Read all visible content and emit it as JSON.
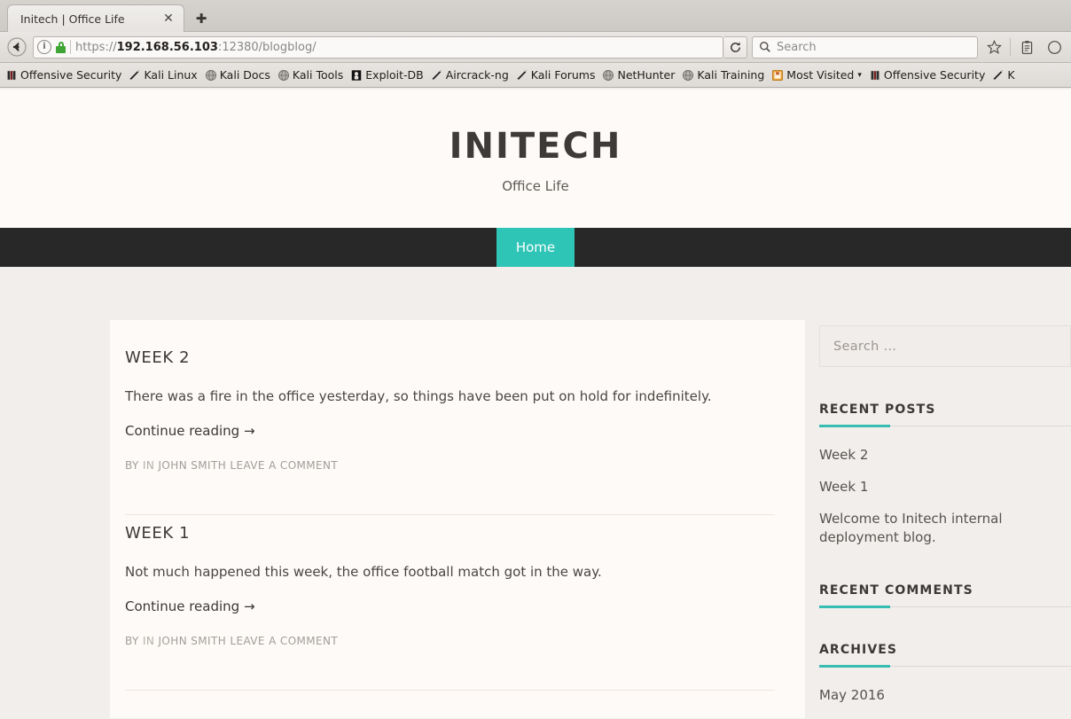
{
  "browser": {
    "tab": {
      "title": "Initech | Office Life",
      "close_icon": "close-icon",
      "newtab_icon": "plus-icon"
    },
    "back_icon": "back-arrow-icon",
    "identity_icon": "info-icon",
    "lock_icon": "lock-icon",
    "url": {
      "scheme": "https://",
      "host": "192.168.56.103",
      "rest": ":12380/blogblog/"
    },
    "reload_icon": "reload-icon",
    "search": {
      "placeholder": "Search",
      "icon": "search-icon"
    },
    "bookmark_star_icon": "star-icon",
    "library_icon": "clipboard-icon",
    "bookmarks": [
      {
        "label": "Offensive Security",
        "icon": "offsec-icon",
        "caret": false
      },
      {
        "label": "Kali Linux",
        "icon": "dragon-icon",
        "caret": false
      },
      {
        "label": "Kali Docs",
        "icon": "globe-icon",
        "caret": false
      },
      {
        "label": "Kali Tools",
        "icon": "globe-icon",
        "caret": false
      },
      {
        "label": "Exploit-DB",
        "icon": "exploitdb-icon",
        "caret": false
      },
      {
        "label": "Aircrack-ng",
        "icon": "dragon-icon",
        "caret": false
      },
      {
        "label": "Kali Forums",
        "icon": "dragon-icon",
        "caret": false
      },
      {
        "label": "NetHunter",
        "icon": "globe-icon",
        "caret": false
      },
      {
        "label": "Kali Training",
        "icon": "globe-icon",
        "caret": false
      },
      {
        "label": "Most Visited",
        "icon": "bookmark-folder-icon",
        "caret": true
      },
      {
        "label": "Offensive Security",
        "icon": "offsec-icon",
        "caret": false
      },
      {
        "label": "K",
        "icon": "dragon-icon",
        "caret": false
      }
    ]
  },
  "site": {
    "title": "INITECH",
    "tagline": "Office Life",
    "nav": [
      {
        "label": "Home",
        "active": true
      }
    ],
    "accent_color": "#2ec4b6",
    "nav_bg_color": "#282828",
    "header_bg_color": "#fdfaf7",
    "page_bg_color": "#f1eeec"
  },
  "posts": [
    {
      "title": "WEEK 2",
      "excerpt": "There was a fire in the office yesterday, so things have been put on hold for indefinitely.",
      "more": "Continue reading →",
      "meta_by": "BY",
      "meta_in": "IN",
      "meta_author": "JOHN SMITH",
      "meta_comments": "LEAVE A COMMENT"
    },
    {
      "title": "WEEK 1",
      "excerpt": "Not much happened this week, the office football match got in the way.",
      "more": "Continue reading →",
      "meta_by": "BY",
      "meta_in": "IN",
      "meta_author": "JOHN SMITH",
      "meta_comments": "LEAVE A COMMENT"
    }
  ],
  "sidebar": {
    "search": {
      "placeholder": "Search …"
    },
    "widgets": [
      {
        "title": "RECENT POSTS",
        "items": [
          "Week 2",
          "Week 1",
          "Welcome to Initech internal deployment blog."
        ]
      },
      {
        "title": "RECENT COMMENTS",
        "items": []
      },
      {
        "title": "ARCHIVES",
        "items": [
          "May 2016"
        ]
      }
    ]
  }
}
